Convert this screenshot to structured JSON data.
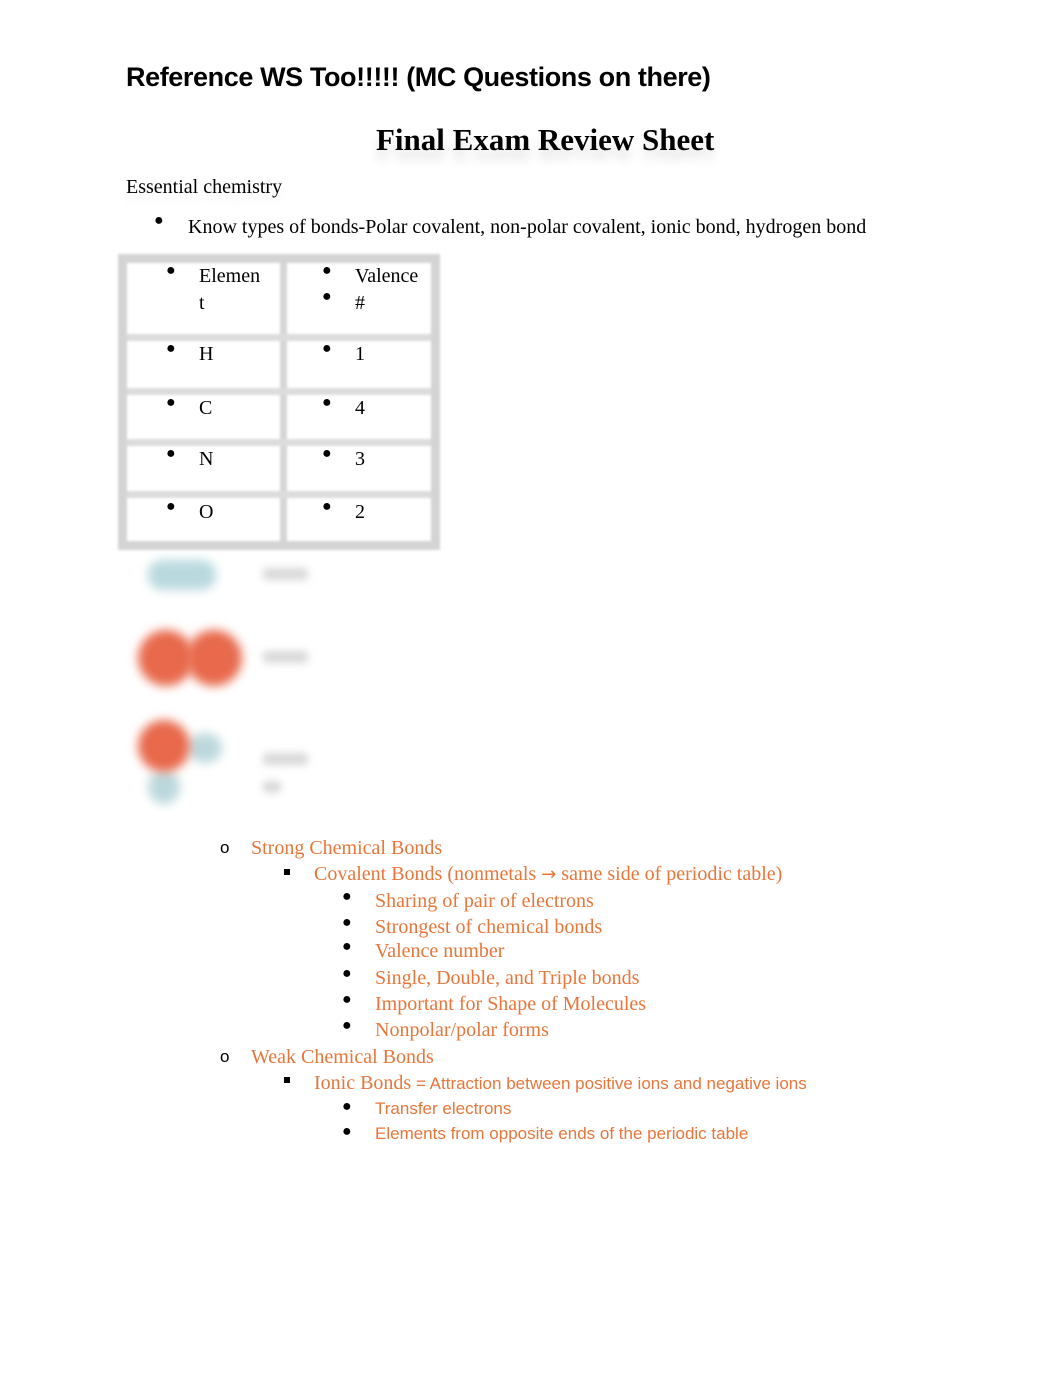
{
  "header": {
    "reference_note": "Reference WS Too!!!!! (MC Questions on there)",
    "title": "Final Exam Review Sheet"
  },
  "section": {
    "heading": "Essential chemistry",
    "bullet": "Know types of bonds-Polar covalent, non-polar covalent, ionic bond, hydrogen bond"
  },
  "valence_table": {
    "headers": {
      "element_line1": "Elemen",
      "element_line2": "t",
      "valence_line1": "Valence",
      "valence_line2": "#"
    },
    "rows": [
      {
        "element": "H",
        "valence": "1"
      },
      {
        "element": "C",
        "valence": "4"
      },
      {
        "element": "N",
        "valence": "3"
      },
      {
        "element": "O",
        "valence": "2"
      }
    ]
  },
  "molecule_images": [
    "blurred-molecule-1",
    "blurred-molecule-2",
    "blurred-molecule-3"
  ],
  "colors": {
    "accent_orange": "#e8763a"
  },
  "bonds": {
    "strong": {
      "label": "Strong Chemical Bonds",
      "covalent": {
        "label_before_arrow": "Covalent Bonds (nonmetals",
        "arrow": "→",
        "label_after_arrow": "same side of periodic table)",
        "points": [
          "Sharing of pair of electrons",
          "Strongest of chemical bonds",
          "Valence number",
          "Single, Double, and Triple bonds",
          "Important for Shape of Molecules",
          "Nonpolar/polar forms"
        ]
      }
    },
    "weak": {
      "label": "Weak Chemical Bonds",
      "ionic": {
        "label": "Ionic Bonds",
        "definition": " = Attraction between positive ions and negative ions",
        "points": [
          "Transfer electrons",
          "Elements from opposite ends of the periodic table"
        ]
      }
    }
  }
}
